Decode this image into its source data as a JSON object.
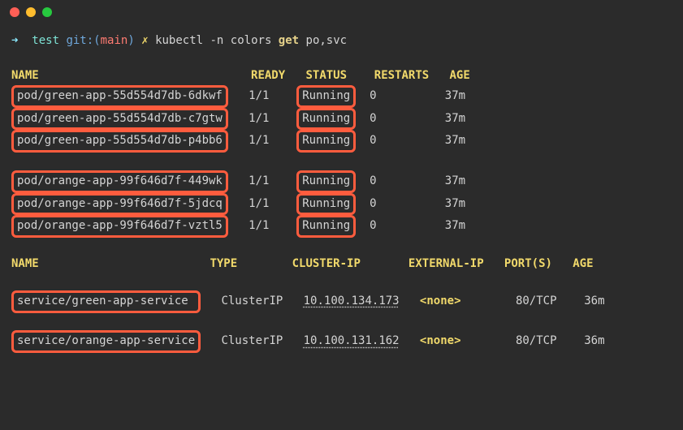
{
  "prompt": {
    "arrow": "➜",
    "dir": "test",
    "git_label": "git:(",
    "branch": "main",
    "git_close": ")",
    "dirty": "✗",
    "cmd_pre": "kubectl -n colors ",
    "cmd_bold": "get",
    "cmd_post": " po,svc"
  },
  "pods": {
    "headers": {
      "name": "NAME",
      "ready": "READY",
      "status": "STATUS",
      "restarts": "RESTARTS",
      "age": "AGE"
    },
    "group1": [
      {
        "name": "pod/green-app-55d554d7db-6dkwf",
        "ready": "1/1",
        "status": "Running",
        "restarts": "0",
        "age": "37m"
      },
      {
        "name": "pod/green-app-55d554d7db-c7gtw",
        "ready": "1/1",
        "status": "Running",
        "restarts": "0",
        "age": "37m"
      },
      {
        "name": "pod/green-app-55d554d7db-p4bb6",
        "ready": "1/1",
        "status": "Running",
        "restarts": "0",
        "age": "37m"
      }
    ],
    "group2": [
      {
        "name": "pod/orange-app-99f646d7f-449wk",
        "ready": "1/1",
        "status": "Running",
        "restarts": "0",
        "age": "37m"
      },
      {
        "name": "pod/orange-app-99f646d7f-5jdcq",
        "ready": "1/1",
        "status": "Running",
        "restarts": "0",
        "age": "37m"
      },
      {
        "name": "pod/orange-app-99f646d7f-vztl5",
        "ready": "1/1",
        "status": "Running",
        "restarts": "0",
        "age": "37m"
      }
    ]
  },
  "svcs": {
    "headers": {
      "name": "NAME",
      "type": "TYPE",
      "clusterip": "CLUSTER-IP",
      "externalip": "EXTERNAL-IP",
      "ports": "PORT(S)",
      "age": "AGE"
    },
    "rows": [
      {
        "name": "service/green-app-service",
        "type": "ClusterIP",
        "clusterip": "10.100.134.173",
        "externalip": "<none>",
        "ports": "80/TCP",
        "age": "36m"
      },
      {
        "name": "service/orange-app-service",
        "type": "ClusterIP",
        "clusterip": "10.100.131.162",
        "externalip": "<none>",
        "ports": "80/TCP",
        "age": "36m"
      }
    ]
  }
}
